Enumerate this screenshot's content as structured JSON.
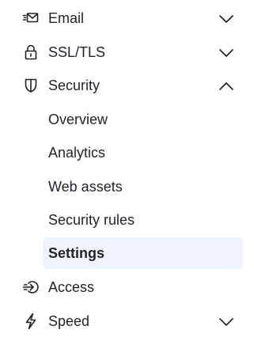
{
  "nav": {
    "email": {
      "label": "Email",
      "icon": "email-icon",
      "expanded": false
    },
    "ssl": {
      "label": "SSL/TLS",
      "icon": "lock-icon",
      "expanded": false
    },
    "security": {
      "label": "Security",
      "icon": "shield-icon",
      "expanded": true,
      "items": [
        {
          "label": "Overview"
        },
        {
          "label": "Analytics"
        },
        {
          "label": "Web assets"
        },
        {
          "label": "Security rules"
        },
        {
          "label": "Settings",
          "active": true
        }
      ]
    },
    "access": {
      "label": "Access",
      "icon": "access-icon"
    },
    "speed": {
      "label": "Speed",
      "icon": "lightning-icon",
      "expanded": false
    }
  },
  "colors": {
    "active_bg": "#eef3fd",
    "text": "#1f2328"
  }
}
